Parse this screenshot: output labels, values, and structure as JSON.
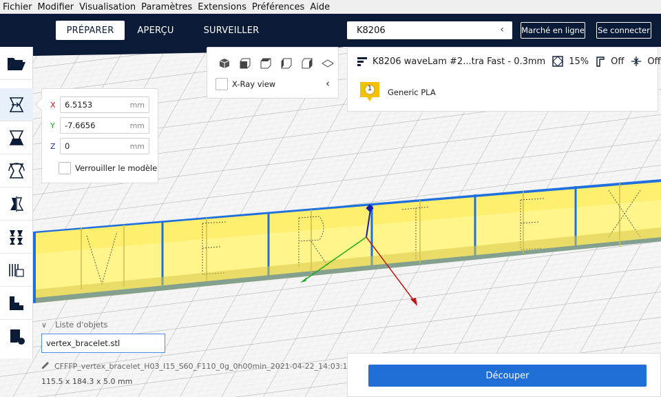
{
  "menu": [
    "Fichier",
    "Modifier",
    "Visualisation",
    "Paramètres",
    "Extensions",
    "Préférences",
    "Aide"
  ],
  "tabs": [
    {
      "label": "PRÉPARER",
      "active": true
    },
    {
      "label": "APERÇU",
      "active": false
    },
    {
      "label": "SURVEILLER",
      "active": false
    }
  ],
  "printer": {
    "name": "K8206"
  },
  "header_buttons": {
    "marketplace": "Marché en ligne",
    "login": "Se connecter"
  },
  "move_tool": {
    "x": {
      "label": "X",
      "value": "6.5153",
      "unit": "mm"
    },
    "y": {
      "label": "Y",
      "value": "-7.6656",
      "unit": "mm"
    },
    "z": {
      "label": "Z",
      "value": "0",
      "unit": "mm"
    },
    "lock_label": "Verrouiller le modèle"
  },
  "view": {
    "xray_label": "X-Ray view"
  },
  "print_settings": {
    "profile": "K8206 waveLam #2...tra Fast - 0.3mm",
    "infill": "15%",
    "support": "Off",
    "adhesion": "Off"
  },
  "material": {
    "extruder": "1",
    "name": "Generic PLA"
  },
  "object_list": {
    "header": "Liste d'objets",
    "items": [
      "vertex_bracelet.stl"
    ]
  },
  "job": {
    "name": "CFFFP_vertex_bracelet_H03_I15_S60_F110_0g_0h00min_2021-04-22_14:03:13",
    "dimensions": "115.5 x 184.3 x 5.0 mm"
  },
  "slice_button": "Découper",
  "colors": {
    "header": "#0b1a36",
    "accent": "#1f6fd6",
    "model": "#fff27a",
    "model_edge": "#1e6fe0"
  }
}
